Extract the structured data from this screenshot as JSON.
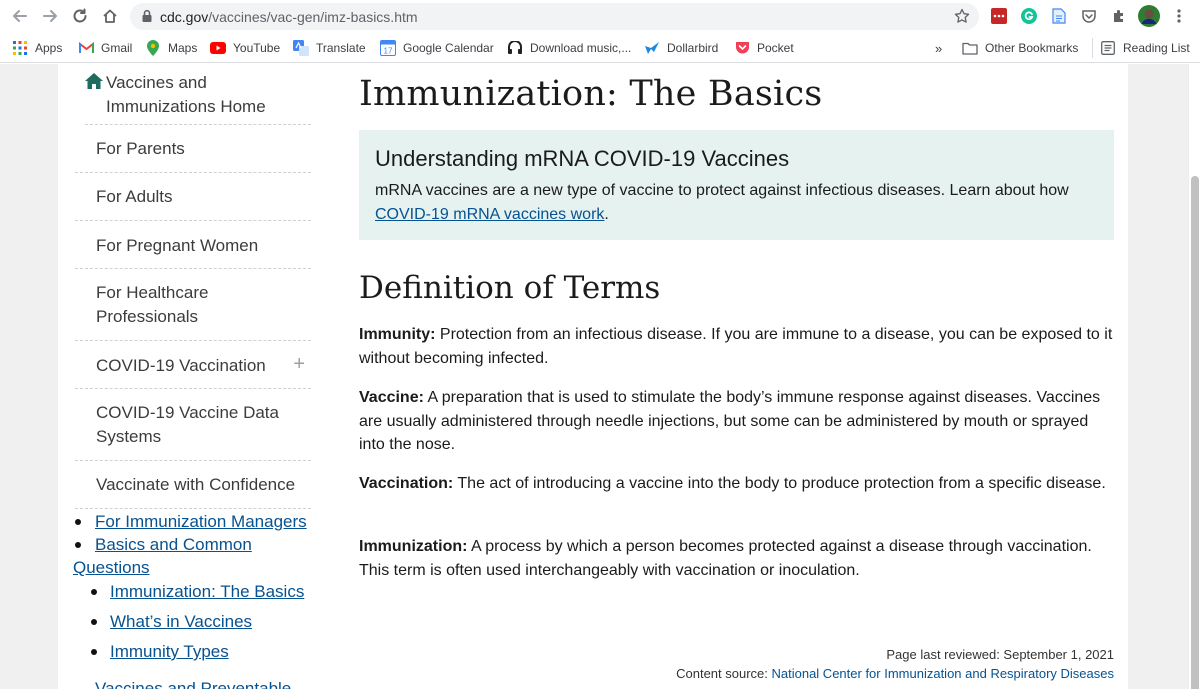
{
  "browser": {
    "url_host": "cdc.gov",
    "url_path": "/vaccines/vac-gen/imz-basics.htm",
    "bookmarks": [
      {
        "label": "Apps",
        "icon": "apps-grid-icon"
      },
      {
        "label": "Gmail",
        "icon": "gmail-icon"
      },
      {
        "label": "Maps",
        "icon": "maps-icon"
      },
      {
        "label": "YouTube",
        "icon": "youtube-icon"
      },
      {
        "label": "Translate",
        "icon": "translate-icon"
      },
      {
        "label": "Google Calendar",
        "icon": "calendar-icon"
      },
      {
        "label": "Download music,...",
        "icon": "download-music-icon"
      },
      {
        "label": "Dollarbird",
        "icon": "dollarbird-icon"
      },
      {
        "label": "Pocket",
        "icon": "pocket-icon"
      }
    ],
    "overflow_label": "»",
    "other_bookmarks": "Other Bookmarks",
    "reading_list": "Reading List",
    "calendar_day": "17"
  },
  "sidebar": {
    "home": "Vaccines and Immunizations Home",
    "items": [
      {
        "label": "For Parents"
      },
      {
        "label": "For Adults"
      },
      {
        "label": "For Pregnant Women"
      },
      {
        "label": "For Healthcare Professionals"
      },
      {
        "label": "COVID-19 Vaccination",
        "expand": "+"
      },
      {
        "label": "COVID-19 Vaccine Data Systems"
      },
      {
        "label": "Vaccinate with Confidence"
      }
    ],
    "links": {
      "immunization_managers": "For Immunization Managers",
      "basics_common_questions": "Basics and Common Questions",
      "sub": [
        "Immunization: The Basics",
        "What’s in Vaccines",
        "Immunity Types"
      ],
      "cut_off": "Vaccines and Preventable"
    }
  },
  "main": {
    "title": "Immunization: The Basics",
    "callout": {
      "title": "Understanding mRNA COVID-19 Vaccines",
      "text": "mRNA vaccines are a new type of vaccine to protect against infectious diseases. Learn about how ",
      "link": "COVID-19 mRNA vaccines work",
      "end": "."
    },
    "section_title": "Definition of Terms",
    "terms": [
      {
        "term": "Immunity:",
        "definition": " Protection from an infectious disease. If you are immune to a disease, you can be exposed to it without becoming infected."
      },
      {
        "term": "Vaccine:",
        "definition": " A preparation that is used to stimulate the body’s immune response against diseases. Vaccines are usually administered through needle injections, but some can be administered by mouth or sprayed into the nose."
      },
      {
        "term": "Vaccination:",
        "definition": " The act of introducing a vaccine into the body to produce protection from a specific disease."
      },
      {
        "term": "Immunization:",
        "definition": " A process by which a person becomes protected against a disease through vaccination. This term is often used interchangeably with vaccination or inoculation."
      }
    ]
  },
  "footer": {
    "reviewed": "Page last reviewed: September 1, 2021",
    "source_label": "Content source: ",
    "source_link": "National Center for Immunization and Respiratory Diseases"
  },
  "colors": {
    "link": "#075290",
    "callout_bg": "#e5f2f0",
    "home_icon": "#1f6b5f"
  }
}
